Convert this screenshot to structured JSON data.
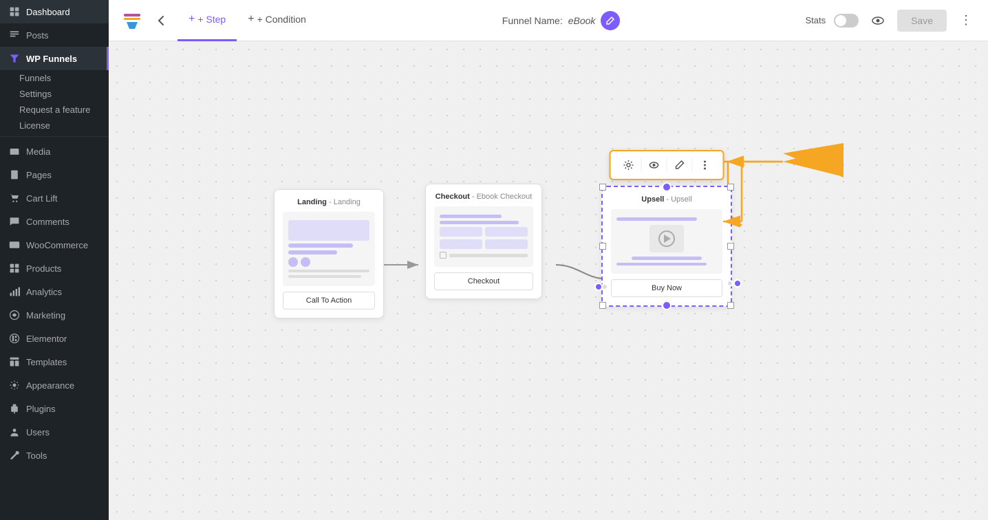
{
  "sidebar": {
    "items": [
      {
        "id": "dashboard",
        "label": "Dashboard",
        "icon": "dashboard"
      },
      {
        "id": "posts",
        "label": "Posts",
        "icon": "posts"
      },
      {
        "id": "wp-funnels",
        "label": "WP Funnels",
        "icon": "funnels",
        "active": true
      },
      {
        "id": "funnels",
        "label": "Funnels",
        "sub": true
      },
      {
        "id": "settings",
        "label": "Settings",
        "sub": true
      },
      {
        "id": "request-feature",
        "label": "Request a feature",
        "sub": true
      },
      {
        "id": "license",
        "label": "License",
        "sub": true
      },
      {
        "id": "media",
        "label": "Media",
        "icon": "media"
      },
      {
        "id": "pages",
        "label": "Pages",
        "icon": "pages"
      },
      {
        "id": "cart-lift",
        "label": "Cart Lift",
        "icon": "cart-lift"
      },
      {
        "id": "comments",
        "label": "Comments",
        "icon": "comments"
      },
      {
        "id": "woocommerce",
        "label": "WooCommerce",
        "icon": "woocommerce"
      },
      {
        "id": "products",
        "label": "Products",
        "icon": "products"
      },
      {
        "id": "analytics",
        "label": "Analytics",
        "icon": "analytics"
      },
      {
        "id": "marketing",
        "label": "Marketing",
        "icon": "marketing"
      },
      {
        "id": "elementor",
        "label": "Elementor",
        "icon": "elementor"
      },
      {
        "id": "templates",
        "label": "Templates",
        "icon": "templates"
      },
      {
        "id": "appearance",
        "label": "Appearance",
        "icon": "appearance"
      },
      {
        "id": "plugins",
        "label": "Plugins",
        "icon": "plugins"
      },
      {
        "id": "users",
        "label": "Users",
        "icon": "users"
      },
      {
        "id": "tools",
        "label": "Tools",
        "icon": "tools"
      }
    ]
  },
  "topbar": {
    "step_label": "+ Step",
    "condition_label": "+ Condition",
    "funnel_name_label": "Funnel Name:",
    "funnel_name_value": "eBook",
    "stats_label": "Stats",
    "save_label": "Save"
  },
  "canvas": {
    "nodes": [
      {
        "id": "landing",
        "type": "Landing",
        "subtitle": "Landing",
        "header": "Landing - Landing",
        "btn_label": "Call To Action"
      },
      {
        "id": "checkout",
        "type": "Checkout",
        "subtitle": "Ebook Checkout",
        "header": "Checkout - Ebook Checkout",
        "btn_label": "Checkout"
      },
      {
        "id": "upsell",
        "type": "Upsell",
        "subtitle": "Upsell",
        "header": "Upsell - Upsell",
        "btn_label": "Buy Now",
        "selected": true
      }
    ],
    "toolbar_buttons": [
      "settings",
      "preview",
      "edit",
      "more"
    ]
  }
}
